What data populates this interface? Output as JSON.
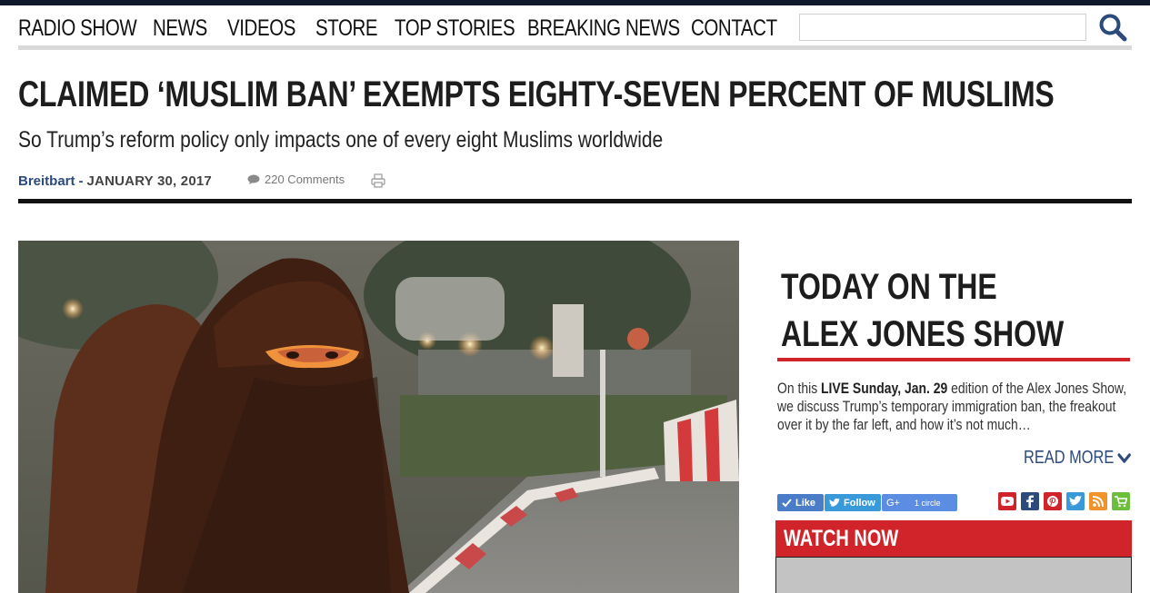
{
  "nav": {
    "items": [
      "RADIO SHOW",
      "NEWS",
      "VIDEOS",
      "STORE",
      "TOP STORIES",
      "BREAKING NEWS",
      "CONTACT"
    ],
    "search_placeholder": ""
  },
  "article": {
    "headline": "CLAIMED ‘MUSLIM BAN’ EXEMPTS EIGHTY-SEVEN PERCENT OF MUSLIMS",
    "subheadline": "So Trump’s reform policy only impacts one of every eight Muslims worldwide",
    "source": "Breitbart",
    "separator": "-",
    "date": "JANUARY 30, 2017",
    "comments": "220 Comments"
  },
  "sidebar": {
    "title": "TODAY ON THE ALEX JONES SHOW",
    "desc_prefix": "On this",
    "desc_bold": "LIVE Sunday, Jan. 29",
    "desc_rest": "edition of the Alex Jones Show, we discuss Trump’s temporary immigration ban, the freakout over it by the far left, and how it’s not much…",
    "read_more": "READ MORE",
    "like_label": "Like",
    "follow_label": "Follow",
    "gplus_label": "G+",
    "gplus_count": "1 circle",
    "watch_now": "WATCH NOW"
  },
  "colors": {
    "accent_red": "#d0242a",
    "link_blue": "#2c4b7c",
    "top_strip": "#10182b"
  },
  "icons": [
    "search-icon",
    "comment-icon",
    "print-icon",
    "chevron-down-icon",
    "youtube-icon",
    "facebook-icon",
    "pinterest-icon",
    "twitter-icon",
    "rss-icon",
    "cart-icon"
  ]
}
